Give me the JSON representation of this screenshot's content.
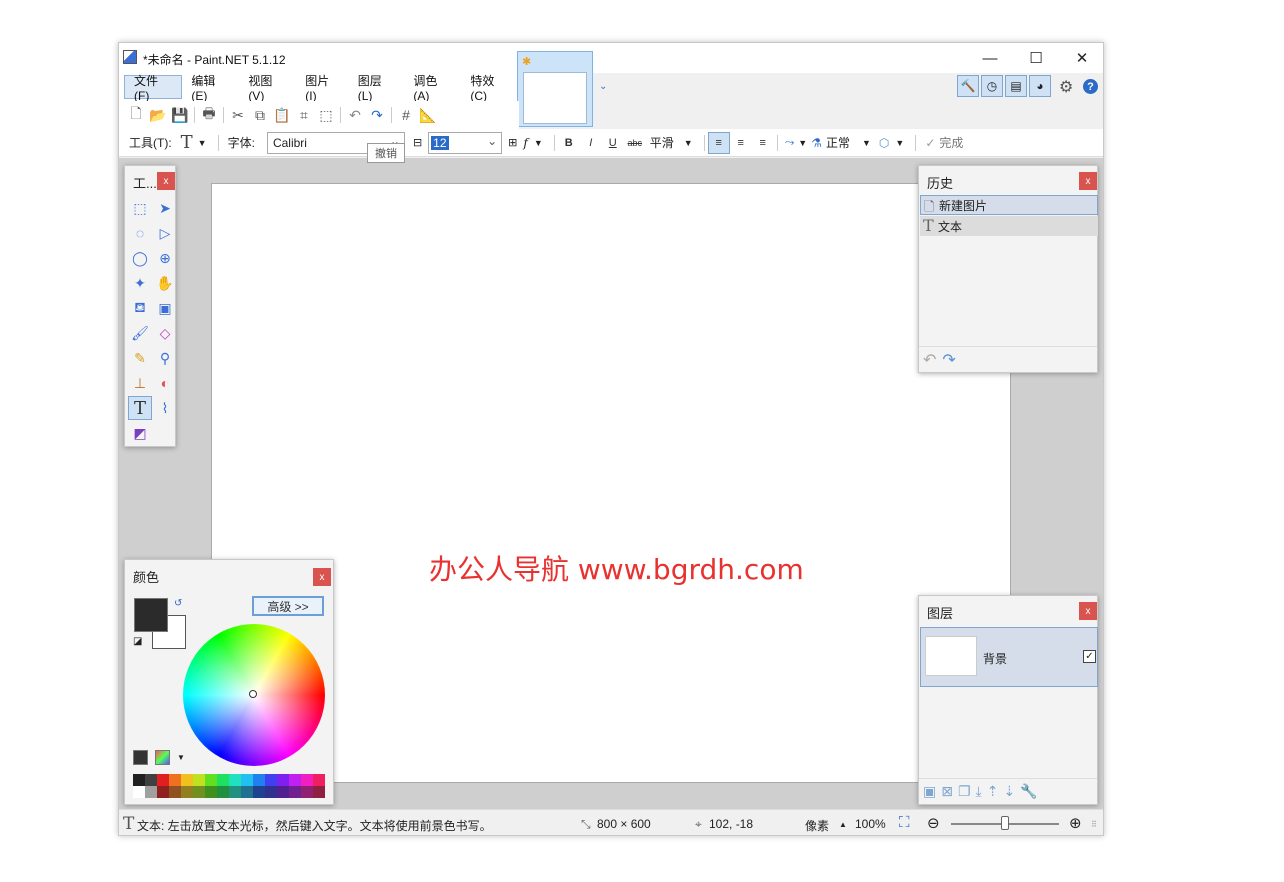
{
  "window": {
    "title": "*未命名 - Paint.NET 5.1.12"
  },
  "menu": [
    {
      "label": "文件(F)"
    },
    {
      "label": "编辑(E)"
    },
    {
      "label": "视图(V)"
    },
    {
      "label": "图片(I)"
    },
    {
      "label": "图层(L)"
    },
    {
      "label": "调色(A)"
    },
    {
      "label": "特效(C)"
    }
  ],
  "toolbar": {
    "tool_label": "工具(T):",
    "font_label": "字体:",
    "font_value": "Calibri",
    "size_value": "12",
    "smoothing": "平滑",
    "blend_mode": "正常",
    "finish": "完成",
    "tooltip": "撤销",
    "bold": "B",
    "italic": "I",
    "underline": "U",
    "strike": "abc"
  },
  "tools_panel": {
    "title": "工..."
  },
  "history_panel": {
    "title": "历史",
    "items": [
      {
        "label": "新建图片"
      },
      {
        "label": "文本"
      }
    ]
  },
  "colors_panel": {
    "title": "颜色",
    "advanced_button": "高级 >>",
    "primary_color": "#2b2b2b",
    "secondary_color": "#ffffff"
  },
  "layers_panel": {
    "title": "图层",
    "layers": [
      {
        "name": "背景",
        "visible": true
      }
    ]
  },
  "watermark": "办公人导航  www.bgrdh.com",
  "status": {
    "hint": "文本: 左击放置文本光标，然后键入文字。文本将使用前景色书写。",
    "image_size": "800 × 600",
    "cursor_pos": "102, -18",
    "unit": "像素",
    "zoom": "100%"
  }
}
